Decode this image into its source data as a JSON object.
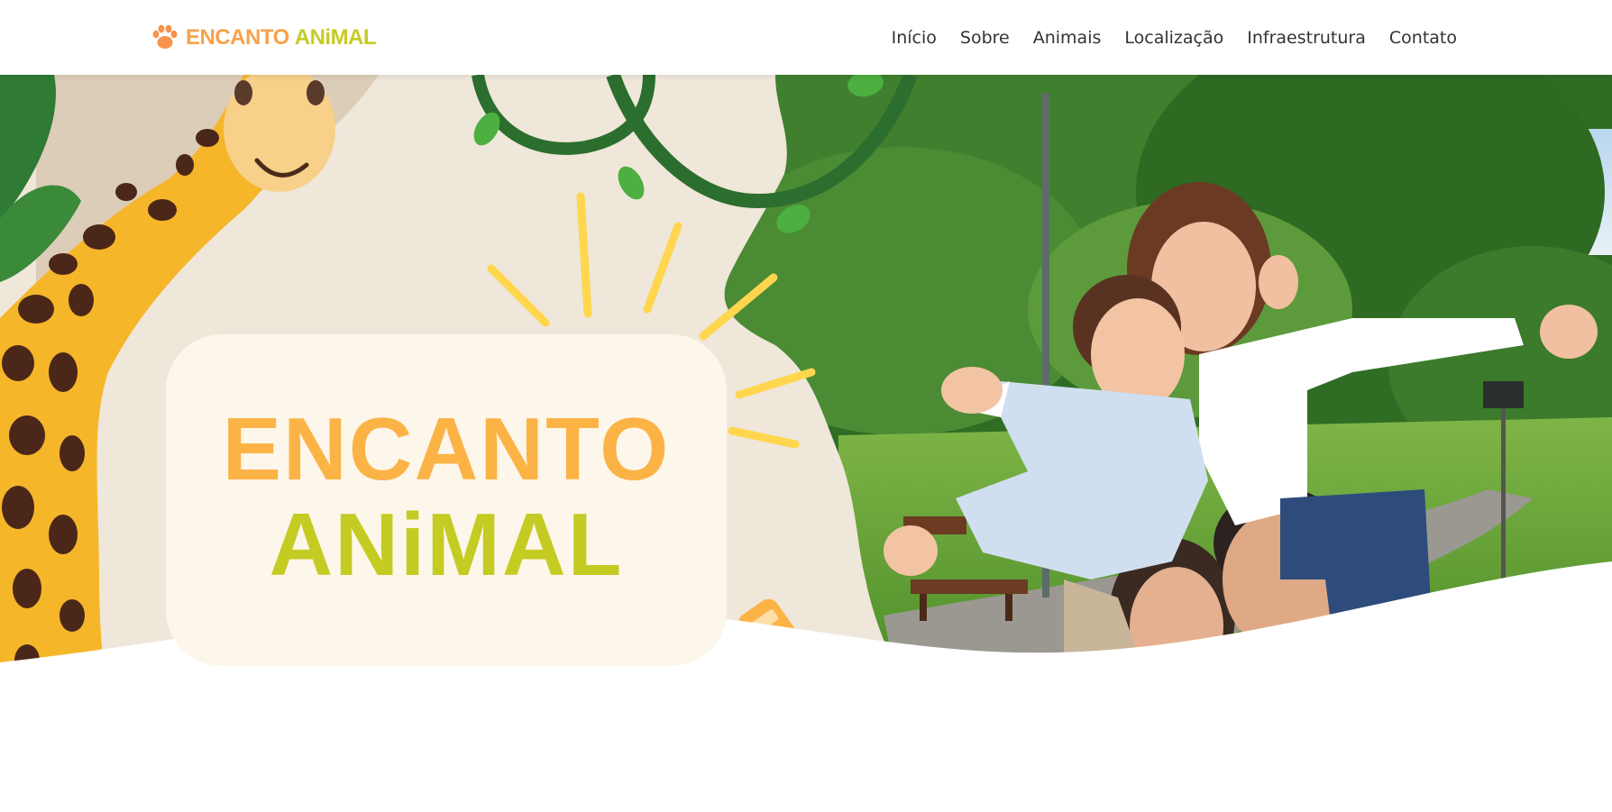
{
  "brand": {
    "logo_word1": "ENCANTO",
    "logo_word2": "ANiMAL",
    "logo_icon": "paw-icon",
    "colors": {
      "orange": "#f7a24a",
      "lime": "#c6cb24"
    }
  },
  "nav": {
    "items": [
      {
        "label": "Início"
      },
      {
        "label": "Sobre"
      },
      {
        "label": "Animais"
      },
      {
        "label": "Localização"
      },
      {
        "label": "Infraestrutura"
      },
      {
        "label": "Contato"
      }
    ]
  },
  "hero": {
    "title_line1": "ENCANTO",
    "title_line2": "ANiMAL"
  }
}
